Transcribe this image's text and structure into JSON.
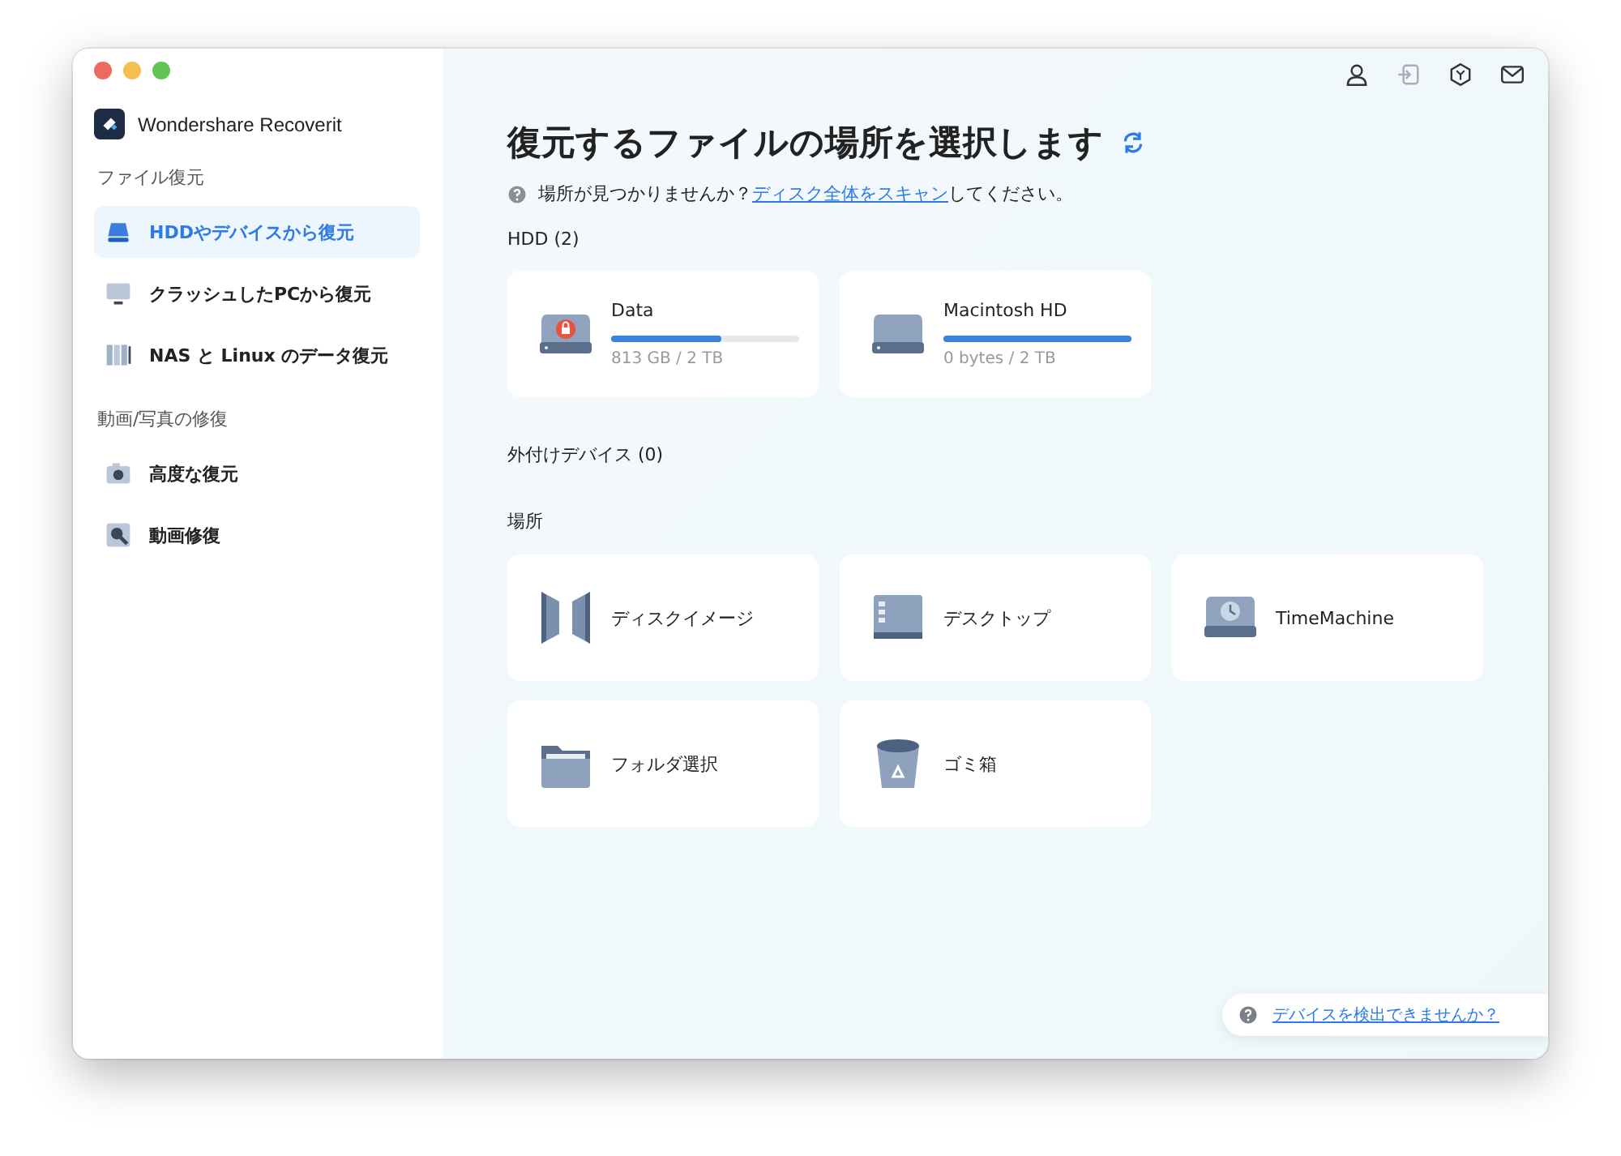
{
  "app": {
    "name": "Wondershare Recoverit"
  },
  "sidebar": {
    "sections": [
      {
        "title": "ファイル復元",
        "items": [
          {
            "label": "HDDやデバイスから復元",
            "kind": "drive",
            "selected": true
          },
          {
            "label": "クラッシュしたPCから復元",
            "kind": "monitor",
            "selected": false
          },
          {
            "label": "NAS と Linux のデータ復元",
            "kind": "server",
            "selected": false
          }
        ]
      },
      {
        "title": "動画/写真の修復",
        "items": [
          {
            "label": "高度な復元",
            "kind": "camera",
            "selected": false
          },
          {
            "label": "動画修復",
            "kind": "repair",
            "selected": false
          }
        ]
      }
    ]
  },
  "main": {
    "title": "復元するファイルの場所を選択します",
    "hint": {
      "before": "場所が見つかりませんか？",
      "link": "ディスク全体をスキャン",
      "after": "してください。"
    },
    "hdd": {
      "heading": "HDD (2)",
      "drives": [
        {
          "name": "Data",
          "locked": true,
          "level": 0.59,
          "usage": "813 GB / 2 TB"
        },
        {
          "name": "Macintosh HD",
          "locked": false,
          "level": 1.0,
          "usage": "0 bytes / 2 TB"
        }
      ]
    },
    "external": {
      "heading": "外付けデバイス (0)"
    },
    "locations": {
      "heading": "場所",
      "items": [
        {
          "label": "ディスクイメージ",
          "kind": "image"
        },
        {
          "label": "デスクトップ",
          "kind": "desktop"
        },
        {
          "label": "TimeMachine",
          "kind": "timemachine"
        },
        {
          "label": "フォルダ選択",
          "kind": "folder"
        },
        {
          "label": "ゴミ箱",
          "kind": "trash"
        }
      ]
    }
  },
  "help_link": "デバイスを検出できませんか？"
}
